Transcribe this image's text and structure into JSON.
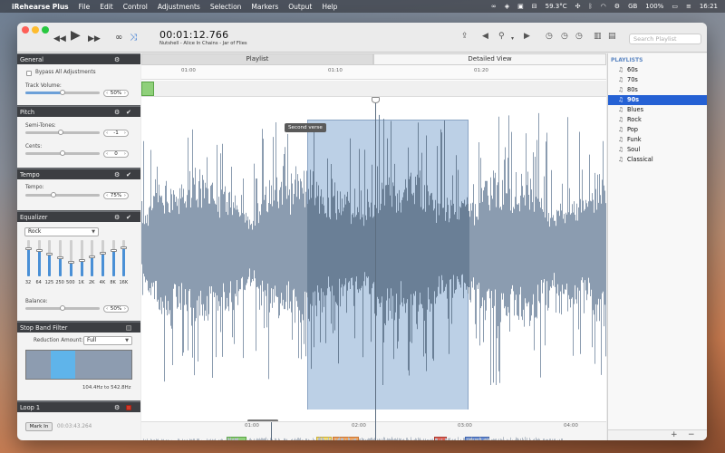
{
  "menubar": {
    "apple_glyph": "",
    "app_name": "iRehearse Plus",
    "items": [
      "File",
      "Edit",
      "Control",
      "Adjustments",
      "Selection",
      "Markers",
      "Output",
      "Help"
    ],
    "status": {
      "cpu_temp": "59.3°C",
      "battery": "100%",
      "lang": "GB",
      "clock": "16:21"
    }
  },
  "window": {
    "time": "00:01:12.766",
    "track": "Nutshell - Alice In Chains - Jar of Flies",
    "search_placeholder": "Search Playlist"
  },
  "sidebar": {
    "general": {
      "title": "General",
      "bypass_label": "Bypass All Adjustments",
      "volume_label": "Track Volume:",
      "volume_value": "50%",
      "volume_fraction": 0.5
    },
    "pitch": {
      "title": "Pitch",
      "semitones_label": "Semi-Tones:",
      "semitones_value": "-1",
      "cents_label": "Cents:",
      "cents_value": "0"
    },
    "tempo": {
      "title": "Tempo",
      "tempo_label": "Tempo:",
      "tempo_value": "75%"
    },
    "equalizer": {
      "title": "Equalizer",
      "preset": "Rock",
      "bands": [
        {
          "label": "32",
          "level": 0.78
        },
        {
          "label": "64",
          "level": 0.72
        },
        {
          "label": "125",
          "level": 0.62
        },
        {
          "label": "250",
          "level": 0.52
        },
        {
          "label": "500",
          "level": 0.4
        },
        {
          "label": "1K",
          "level": 0.44
        },
        {
          "label": "2K",
          "level": 0.55
        },
        {
          "label": "4K",
          "level": 0.65
        },
        {
          "label": "8K",
          "level": 0.72
        },
        {
          "label": "16K",
          "level": 0.8
        }
      ],
      "balance_label": "Balance:",
      "balance_value": "50%"
    },
    "stop_band": {
      "title": "Stop Band Filter",
      "reduction_label": "Reduction Amount:",
      "reduction_value": "Full",
      "range": "104.4Hz to 542.8Hz"
    },
    "loop": {
      "title": "Loop 1",
      "mark_in": "Mark In",
      "mark_time": "00:03:43.264"
    }
  },
  "main": {
    "tabs": [
      {
        "label": "Playlist",
        "active": false
      },
      {
        "label": "Detailed View",
        "active": true
      }
    ],
    "timeline_ticks": [
      "01:00",
      "01:10",
      "01:20"
    ],
    "region_label": "Second verse",
    "mini_ticks": [
      "01:00",
      "02:00",
      "03:00",
      "04:00"
    ]
  },
  "playlists": {
    "header": "PLAYLISTS",
    "items": [
      {
        "label": "60s",
        "selected": false
      },
      {
        "label": "70s",
        "selected": false
      },
      {
        "label": "80s",
        "selected": false
      },
      {
        "label": "90s",
        "selected": true
      },
      {
        "label": "Blues",
        "selected": false
      },
      {
        "label": "Rock",
        "selected": false
      },
      {
        "label": "Pop",
        "selected": false
      },
      {
        "label": "Funk",
        "selected": false
      },
      {
        "label": "Soul",
        "selected": false
      },
      {
        "label": "Classical",
        "selected": false
      }
    ],
    "add_label": "+",
    "remove_label": "−"
  },
  "colors": {
    "accent": "#2561d4",
    "selection": "#bcd0e6",
    "waveform": "#8b9cb0",
    "wave_selected": "#6a7f96"
  }
}
